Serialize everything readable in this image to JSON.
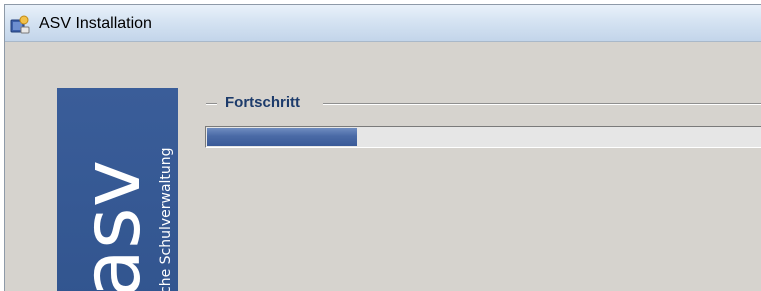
{
  "window": {
    "title": "ASV Installation",
    "icon": "installer-app-icon"
  },
  "sidebar": {
    "logo_text": "asv",
    "logo_subtitle": "che Schulverwaltung",
    "background_color": "#3a5d99"
  },
  "progress_group": {
    "label": "Fortschritt",
    "progress_fraction": 0.265,
    "fill_color": "#4a6aa6"
  }
}
